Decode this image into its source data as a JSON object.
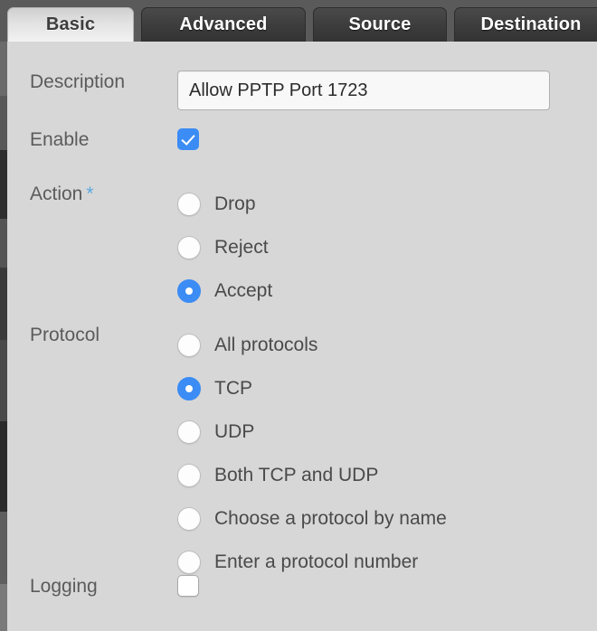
{
  "tabs": [
    {
      "label": "Basic",
      "active": true
    },
    {
      "label": "Advanced",
      "active": false
    },
    {
      "label": "Source",
      "active": false
    },
    {
      "label": "Destination",
      "active": false
    }
  ],
  "form": {
    "description": {
      "label": "Description",
      "value": "Allow PPTP Port 1723",
      "placeholder": ""
    },
    "enable": {
      "label": "Enable",
      "checked": true
    },
    "action": {
      "label": "Action",
      "required_marker": "*",
      "options": [
        {
          "label": "Drop",
          "selected": false
        },
        {
          "label": "Reject",
          "selected": false
        },
        {
          "label": "Accept",
          "selected": true
        }
      ]
    },
    "protocol": {
      "label": "Protocol",
      "options": [
        {
          "label": "All protocols",
          "selected": false
        },
        {
          "label": "TCP",
          "selected": true
        },
        {
          "label": "UDP",
          "selected": false
        },
        {
          "label": "Both TCP and UDP",
          "selected": false
        },
        {
          "label": "Choose a protocol by name",
          "selected": false
        },
        {
          "label": "Enter a protocol number",
          "selected": false
        }
      ]
    },
    "logging": {
      "label": "Logging",
      "checked": false
    }
  },
  "colors": {
    "accent": "#3b8cf4",
    "required_star": "#5da9e0",
    "panel_bg": "#d7d7d7",
    "tab_inactive_bg": "#3c3c3c",
    "tab_active_bg": "#e8e8e8"
  }
}
